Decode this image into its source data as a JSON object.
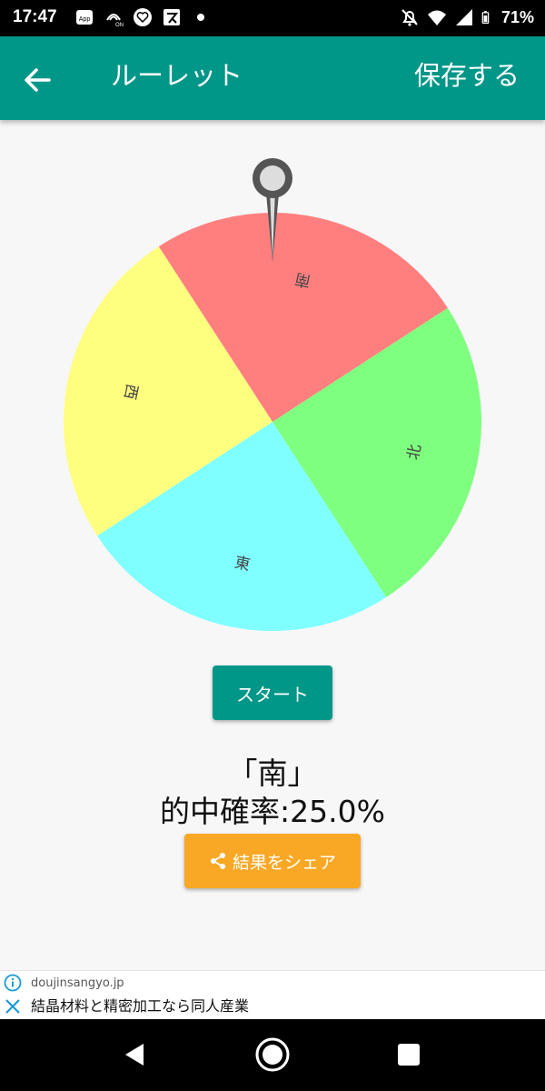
{
  "status": {
    "time": "17:47",
    "battery": "71%",
    "left_icons": [
      "app-notification-icon",
      "nfc-on-icon",
      "heart-app-icon",
      "x-app-icon",
      "dot-icon"
    ],
    "right_icons": [
      "notifications-off-icon",
      "wifi-icon",
      "signal-icon",
      "battery-icon"
    ]
  },
  "appbar": {
    "title": "ルーレット",
    "save_label": "保存する"
  },
  "wheel": {
    "segments": [
      {
        "label": "南",
        "color": "#FF7F7F"
      },
      {
        "label": "北",
        "color": "#7FFF7F"
      },
      {
        "label": "東",
        "color": "#7FFFFF"
      },
      {
        "label": "西",
        "color": "#FFFF7F"
      }
    ]
  },
  "controls": {
    "start_label": "スタート",
    "result": "「南」",
    "hit_rate": "的中確率:25.0%",
    "share_label": "結果をシェア"
  },
  "ad": {
    "domain": "doujinsangyo.jp",
    "text": "結晶材料と精密加工なら同人産業"
  },
  "colors": {
    "primary": "#009688",
    "accent": "#F9A825",
    "background": "#f7f7f7"
  }
}
